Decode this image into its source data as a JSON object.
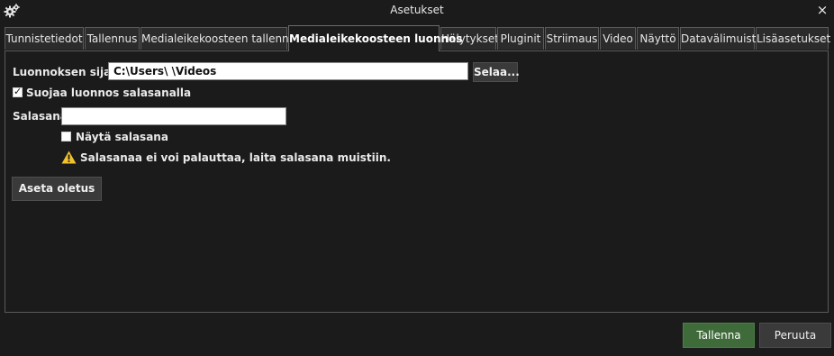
{
  "window": {
    "title": "Asetukset",
    "icon": "gear-icon",
    "close_glyph": "×"
  },
  "tabs": [
    {
      "label": "Tunnistetiedot"
    },
    {
      "label": "Tallennus"
    },
    {
      "label": "Medialeikekoosteen tallennus"
    },
    {
      "label": "Medialeikekoosteen luonnos",
      "active": true
    },
    {
      "label": "Hälytykset"
    },
    {
      "label": "Pluginit"
    },
    {
      "label": "Striimaus"
    },
    {
      "label": "Video"
    },
    {
      "label": "Näyttö"
    },
    {
      "label": "Datavälimuisti"
    },
    {
      "label": "Lisäasetukset"
    }
  ],
  "draft": {
    "location_label": "Luonnoksen sijainti",
    "location_value": "C:\\Users\\                    \\Videos",
    "browse_label": "Selaa...",
    "protect_label": "Suojaa luonnos salasanalla",
    "protect_checked": true,
    "password_label": "Salasana",
    "password_value": "",
    "show_password_label": "Näytä salasana",
    "show_password_checked": false,
    "warning_text": "Salasanaa ei voi palauttaa, laita salasana muistiin.",
    "set_default_label": "Aseta oletus"
  },
  "footer": {
    "save_label": "Tallenna",
    "cancel_label": "Peruuta"
  },
  "colors": {
    "save_bg": "#3f6b3a",
    "warning": "#f2c12e",
    "background": "#1b1b1b"
  }
}
